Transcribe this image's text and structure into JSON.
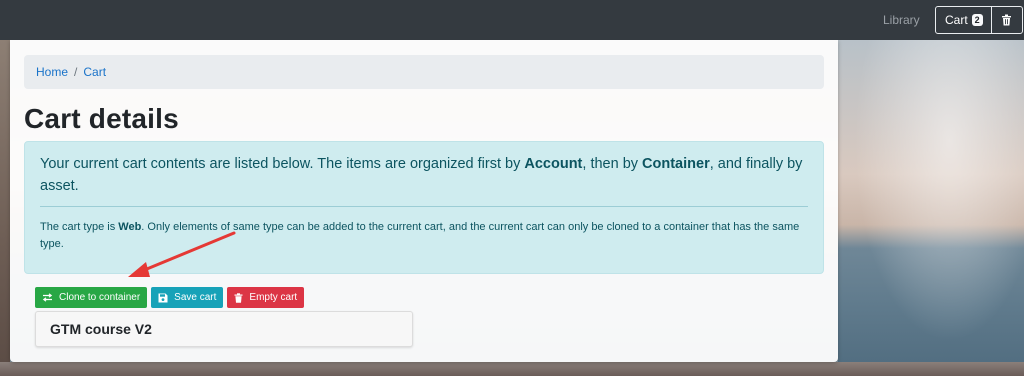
{
  "navbar": {
    "library_label": "Library",
    "cart_label": "Cart",
    "cart_count": "2"
  },
  "breadcrumb": {
    "items": [
      "Home",
      "Cart"
    ]
  },
  "page": {
    "title": "Cart details"
  },
  "alert": {
    "lead_part1": "Your current cart contents are listed below. The items are organized first by ",
    "lead_bold1": "Account",
    "lead_part2": ", then by ",
    "lead_bold2": "Container",
    "lead_part3": ", and finally by asset.",
    "sub_part1": "The cart type is ",
    "sub_bold": "Web",
    "sub_part2": ". Only elements of same type can be added to the current cart, and the current cart can only be cloned to a container that has the same type."
  },
  "actions": {
    "clone_label": "Clone to container",
    "save_label": "Save cart",
    "empty_label": "Empty cart"
  },
  "cart_items": [
    {
      "title": "GTM course V2"
    }
  ],
  "colors": {
    "navbar": "#343a40",
    "success": "#28a745",
    "info": "#17a2b8",
    "danger": "#dc3545",
    "annotation_arrow": "#e53935"
  },
  "icons": {
    "clone": "exchange-arrows-icon",
    "save": "floppy-disk-icon",
    "empty": "trash-icon",
    "navbar_trash": "trash-icon"
  }
}
